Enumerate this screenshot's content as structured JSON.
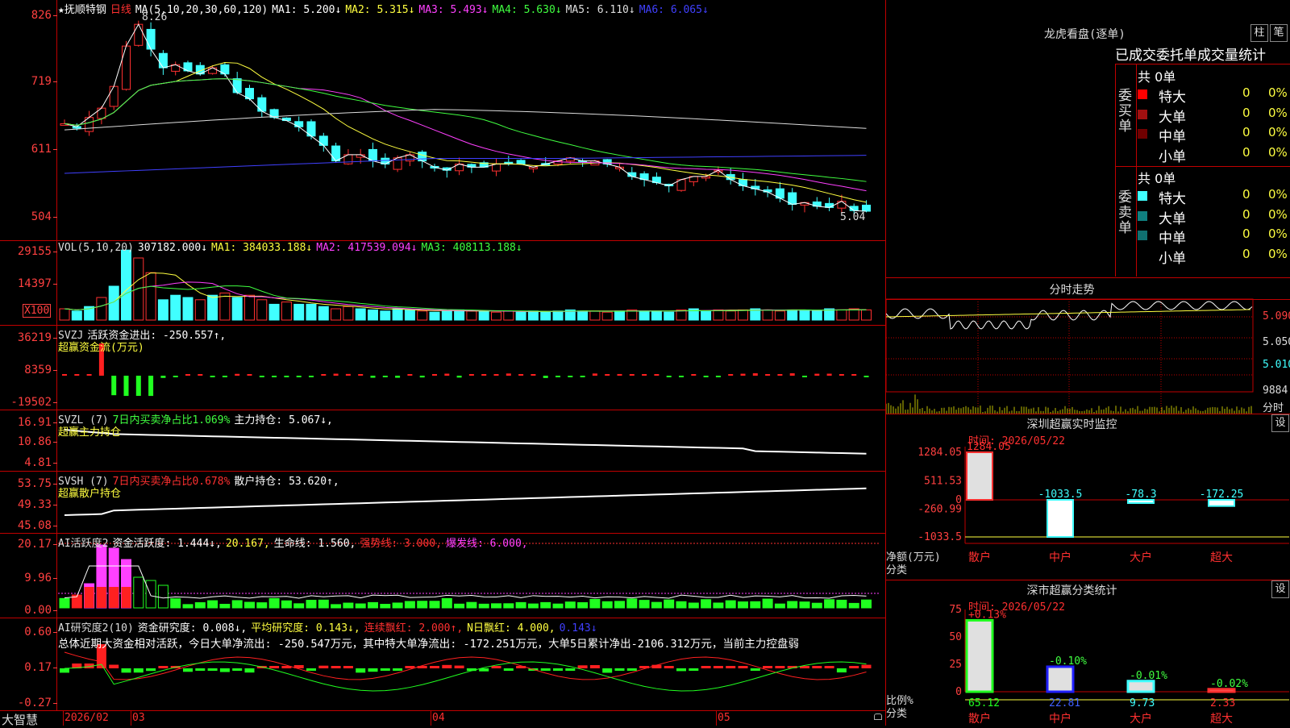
{
  "main_chart": {
    "title": "★抚顺特钢",
    "period": "日线",
    "ma_label": "MA(5,10,20,30,60,120)",
    "ma": [
      {
        "label": "MA1:",
        "value": "5.200↓",
        "color": "#ffffff"
      },
      {
        "label": "MA2:",
        "value": "5.315↓",
        "color": "#ffff40"
      },
      {
        "label": "MA3:",
        "value": "5.493↓",
        "color": "#ff40ff"
      },
      {
        "label": "MA4:",
        "value": "5.630↓",
        "color": "#40ff40"
      },
      {
        "label": "MA5:",
        "value": "6.110↓",
        "color": "#dddddd"
      },
      {
        "label": "MA6:",
        "value": "6.065↓",
        "color": "#4040ff"
      }
    ],
    "high_label": "8.26",
    "low_label": "5.04",
    "y_ticks": [
      "826",
      "719",
      "611",
      "504"
    ]
  },
  "vol_chart": {
    "header": [
      {
        "text": "VOL(5,10,20)",
        "color": "#dddddd"
      },
      {
        "text": "307182.000↓",
        "color": "#ffffff"
      },
      {
        "text": "MA1: 384033.188↓",
        "color": "#ffff40"
      },
      {
        "text": "MA2: 417539.094↓",
        "color": "#ff40ff"
      },
      {
        "text": "MA3: 408113.188↓",
        "color": "#40ff40"
      }
    ],
    "y_ticks": [
      "29155",
      "14397"
    ],
    "unit": "X100"
  },
  "svzj": {
    "header": [
      {
        "text": "SVZJ",
        "color": "#dddddd"
      },
      {
        "text": "活跃资金进出: -250.557↑,",
        "color": "#ffffff"
      }
    ],
    "subtitle": "超赢资金流(万元)",
    "y_ticks": [
      "36219",
      "8359",
      "-19502"
    ]
  },
  "svzl": {
    "header": [
      {
        "text": "SVZL (7)",
        "color": "#dddddd"
      },
      {
        "text": "7日内买卖净占比1.069%",
        "color": "#40ff40"
      },
      {
        "text": "主力持仓: 5.067↓,",
        "color": "#ffffff"
      }
    ],
    "subtitle": "超赢主力持仓",
    "y_ticks": [
      "16.91",
      "10.86",
      "4.81"
    ]
  },
  "svsh": {
    "header": [
      {
        "text": "SVSH (7)",
        "color": "#dddddd"
      },
      {
        "text": "7日内买卖净占比0.678%",
        "color": "#ff3030"
      },
      {
        "text": "散户持仓: 53.620↑,",
        "color": "#ffffff"
      }
    ],
    "subtitle": "超赢散户持仓",
    "y_ticks": [
      "53.75",
      "49.33",
      "45.08"
    ]
  },
  "ai_active": {
    "header": [
      {
        "text": "AI活跃度2",
        "color": "#dddddd"
      },
      {
        "text": "资金活跃度: 1.444↓,",
        "color": "#ffffff"
      },
      {
        "text": "20.167,",
        "color": "#ffff40"
      },
      {
        "text": "生命线: 1.560,",
        "color": "#ffffff"
      },
      {
        "text": "强势线: 3.000,",
        "color": "#ff3030"
      },
      {
        "text": "爆发线: 6.000,",
        "color": "#ff40ff"
      }
    ],
    "y_ticks": [
      "20.17",
      "9.96",
      "0.00"
    ]
  },
  "ai_research": {
    "header": [
      {
        "text": "AI研究度2(10)",
        "color": "#dddddd"
      },
      {
        "text": "资金研究度: 0.008↓,",
        "color": "#ffffff"
      },
      {
        "text": "平均研究度: 0.143↓,",
        "color": "#ffff40"
      },
      {
        "text": "连续飘红: 2.000↑,",
        "color": "#ff3030"
      },
      {
        "text": "N日飘红: 4.000,",
        "color": "#ffff40"
      },
      {
        "text": "0.143↓",
        "color": "#4040ff"
      }
    ],
    "summary": "总体近期大资金相对活跃，今日大单净流出: -250.547万元，其中特大单净流出: -172.251万元，大单5日累计净出-2106.312万元，当前主力控盘弱",
    "y_ticks": [
      "0.60",
      "0.17",
      "-0.27"
    ]
  },
  "bottom_axis": {
    "brand": "大智慧",
    "dates": [
      "2026/02",
      "03",
      "04",
      "05"
    ]
  },
  "dragon_tiger": {
    "title": "龙虎看盘(逐单)",
    "btn_col": "柱",
    "btn_bi": "笔",
    "subtitle": "已成交委托单成交量统计",
    "buy_label": "委买单",
    "sell_label": "委卖单",
    "buy_total": "共 0单",
    "sell_total": "共 0单",
    "buy_rows": [
      {
        "name": "特大",
        "count": "0",
        "pct": "0%",
        "color": "#ff0000"
      },
      {
        "name": "大单",
        "count": "0",
        "pct": "0%",
        "color": "#a01010"
      },
      {
        "name": "中单",
        "count": "0",
        "pct": "0%",
        "color": "#700000"
      },
      {
        "name": "小单",
        "count": "0",
        "pct": "0%",
        "color": "#000000"
      }
    ],
    "sell_rows": [
      {
        "name": "特大",
        "count": "0",
        "pct": "0%",
        "color": "#40ffff"
      },
      {
        "name": "大单",
        "count": "0",
        "pct": "0%",
        "color": "#108080"
      },
      {
        "name": "中单",
        "count": "0",
        "pct": "0%",
        "color": "#107070"
      },
      {
        "name": "小单",
        "count": "0",
        "pct": "0%",
        "color": "#000000"
      }
    ]
  },
  "intraday": {
    "title": "分时走势",
    "price_ticks": [
      "5.090",
      "5.050",
      "5.010"
    ],
    "vol_tick": "9884",
    "vol_unit": "分时"
  },
  "sz_monitor": {
    "title": "深圳超赢实时监控",
    "settings": "设",
    "time_label": "时间: 2026/05/22",
    "y_ticks": [
      "1284.05",
      "511.53",
      "0",
      "-260.99",
      "-1033.5"
    ],
    "ylabel": "净额(万元)",
    "xlabel": "分类",
    "chart_data": {
      "type": "bar",
      "categories": [
        "散户",
        "中户",
        "大户",
        "超大"
      ],
      "values": [
        1284.05,
        -1033.5,
        -78.3,
        -172.25
      ],
      "labels": [
        "1284.05",
        "-1033.5",
        "-78.3",
        "-172.25"
      ]
    }
  },
  "sz_class": {
    "title": "深市超赢分类统计",
    "settings": "设",
    "time_label": "时间: 2026/05/22",
    "y_ticks": [
      "75",
      "50",
      "25",
      "0"
    ],
    "ylabel": "比例%",
    "xlabel": "分类",
    "chart_data": {
      "type": "bar",
      "categories": [
        "散户",
        "中户",
        "大户",
        "超大"
      ],
      "values": [
        65.12,
        22.81,
        9.73,
        2.33
      ],
      "changes": [
        "+0.13%",
        "-0.10%",
        "-0.01%",
        "-0.02%"
      ],
      "ylim": [
        0,
        75
      ]
    }
  }
}
